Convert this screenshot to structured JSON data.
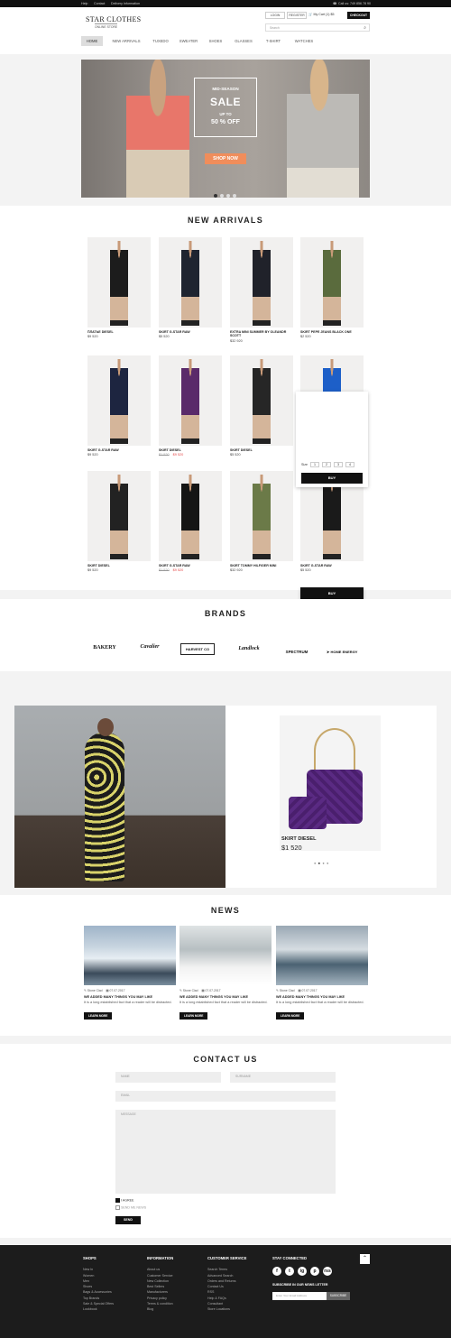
{
  "topbar": {
    "links": [
      "Help",
      "Contact",
      "Delivery Information"
    ],
    "call": "Call us:",
    "phone": "749 856 78 90"
  },
  "header": {
    "logo_main": "STAR CLOTHES",
    "logo_sub": "ONLINE STORE",
    "login": "LOGIN",
    "register": "REGISTER",
    "cart": "My Cart (1)  $5",
    "checkout": "CHECKOUT",
    "search_placeholder": "Search"
  },
  "nav": [
    "HOME",
    "NEW ARRIVALS",
    "TUXEDO",
    "SWEATER",
    "SHOES",
    "GLASSES",
    "T-SHIRT",
    "WATCHES"
  ],
  "hero": {
    "kicker": "MID-SEASON",
    "title": "SALE",
    "upto": "UP TO",
    "percent": "50 % OFF",
    "cta": "SHOP NOW"
  },
  "new_arrivals": {
    "title": "NEW ARRIVALS",
    "products": [
      {
        "name": "ПЛАТЬЕ DIESEL",
        "price": "$9 520",
        "old": "",
        "color": "#1c1c1c"
      },
      {
        "name": "SKIRT G-STAR RAW",
        "price": "$5 520",
        "old": "",
        "color": "#1e2430"
      },
      {
        "name": "EXTRA MINI SUMMER BY OLEANDR SCOTT",
        "price": "$32 920",
        "old": "",
        "color": "#20222a"
      },
      {
        "name": "SKIRT PEPE JEANS BLACK ONE",
        "price": "$2 520",
        "old": "",
        "color": "#5a6b3d"
      },
      {
        "name": "SKIRT G-STAR RAW",
        "price": "$9 520",
        "old": "",
        "color": "#1d2540"
      },
      {
        "name": "SKIRT DIESEL",
        "price": "$9 520",
        "old": "$1 520",
        "color": "#5a2a6a"
      },
      {
        "name": "SKIRT DIESEL",
        "price": "$5 520",
        "old": "",
        "color": "#262626"
      },
      {
        "name": "TOP TOMMY HILFIGER",
        "price": "$5 520",
        "old": "",
        "color": "#1d5fc8"
      },
      {
        "name": "SKIRT DIESEL",
        "price": "$9 520",
        "old": "",
        "color": "#222"
      },
      {
        "name": "SKIRT G-STAR RAW",
        "price": "$9 520",
        "old": "$1 520",
        "color": "#151515"
      },
      {
        "name": "SKIRT TOMMY HILFIGER MINI",
        "price": "$32 920",
        "old": "",
        "color": "#6b7a48"
      },
      {
        "name": "SKIRT G-STAR RAW",
        "price": "$5 520",
        "old": "",
        "color": "#1a1a1a"
      }
    ],
    "size_label": "Size",
    "sizes": [
      "1",
      "2",
      "3",
      "4"
    ],
    "buy": "BUY"
  },
  "brands": {
    "title": "BRANDS",
    "items": [
      "BAKERY",
      "Cavalier",
      "HARVEST CO",
      "Landlock",
      "SPECTRUM",
      "HOME ENERGY"
    ]
  },
  "feature": {
    "name": "SKIRT DIESEL",
    "price": "$1 520"
  },
  "news": {
    "title": "NEWS",
    "items": [
      {
        "author": "Stone Clad",
        "date": "07.07.2017",
        "title": "WE ADDED MANY THINGS YOU MAY LIKE",
        "text": "It is a long established fact that a reader will be distracted.",
        "more": "LEARN MORE"
      },
      {
        "author": "Stone Clad",
        "date": "07.07.2017",
        "title": "WE ADDED MANY THINGS YOU MAY LIKE",
        "text": "It is a long established fact that a reader will be distracted.",
        "more": "LEARN MORE"
      },
      {
        "author": "Stone Clad",
        "date": "07.07.2017",
        "title": "WE ADDED MANY THINGS YOU MAY LIKE",
        "text": "It is a long established fact that a reader will be distracted.",
        "more": "LEARN MORE"
      }
    ]
  },
  "contact": {
    "title": "CONTACT US",
    "name": "NAME",
    "surname": "SURNAME",
    "email": "EMAIL",
    "message": "MESSAGE",
    "check1": "I AGREE",
    "check2": "SEND ME NEWS",
    "send": "SEND"
  },
  "footer": {
    "shops": {
      "title": "SHOPS",
      "items": [
        "New In",
        "Women",
        "Men",
        "Shoes",
        "Bags & Accessories",
        "Top Brands",
        "Sale & Special Offers",
        "Lookbook"
      ]
    },
    "information": {
      "title": "INFORMATION",
      "items": [
        "About us",
        "Customer Service",
        "New Collection",
        "Best Sellers",
        "Manufacturers",
        "Privacy policy",
        "Terms & condition",
        "Blog"
      ]
    },
    "service": {
      "title": "CUSTOMER SERVICE",
      "items": [
        "Search Terms",
        "Advanced Search",
        "Orders and Returns",
        "Contact Us",
        "RSS",
        "Help & FAQs",
        "Consultant",
        "Store Locations"
      ]
    },
    "connected": "STAY CONNECTED",
    "social": [
      "f",
      "t",
      "ig",
      "p",
      "rss"
    ],
    "newsletter": "SUBSCRIBE IN OUR NEWS LETTER",
    "email_placeholder": "Enter Your Email Address",
    "subscribe": "SUBSCRIBE"
  }
}
